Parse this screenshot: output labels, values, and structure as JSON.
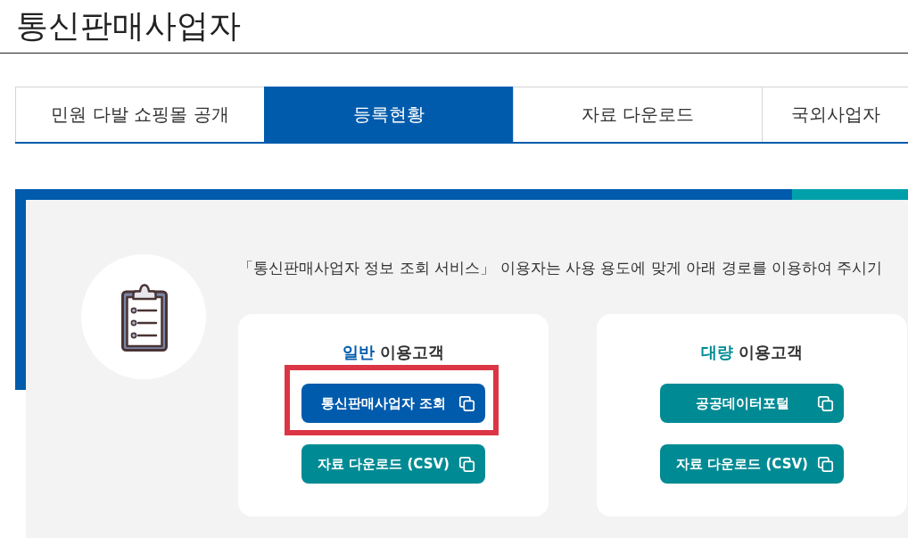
{
  "page": {
    "title": "통신판매사업자"
  },
  "tabs": [
    {
      "label": "민원 다발 쇼핑몰 공개",
      "selected": false
    },
    {
      "label": "등록현황",
      "selected": true
    },
    {
      "label": "자료 다운로드",
      "selected": false
    },
    {
      "label": "국외사업자",
      "selected": false
    }
  ],
  "notice": "「통신판매사업자 정보 조회 서비스」 이용자는 사용 용도에 맞게 아래 경로를 이용하여 주시기",
  "cards": [
    {
      "title_accent": "일반",
      "title": "이용고객",
      "color": "#005bac",
      "buttons": [
        {
          "label": "통신판매사업자 조회",
          "color": "#005bac",
          "highlighted": true
        },
        {
          "label": "자료 다운로드 (CSV)",
          "color": "#008b94",
          "highlighted": false
        }
      ]
    },
    {
      "title_accent": "대량",
      "title": "이용고객",
      "color": "#008b94",
      "buttons": [
        {
          "label": "공공데이터포털",
          "color": "#008b94",
          "highlighted": false
        },
        {
          "label": "자료 다운로드 (CSV)",
          "color": "#008b94",
          "highlighted": false
        }
      ]
    }
  ]
}
